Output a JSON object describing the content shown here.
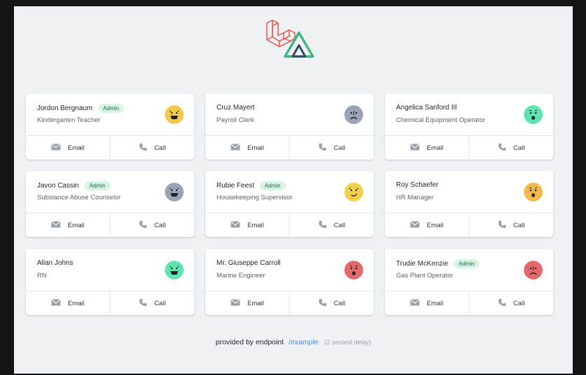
{
  "cards": [
    {
      "name": "Jordon Bergnaum",
      "admin": "Admin",
      "role": "Kindergarten Teacher",
      "avatar_color": "#f2c94c",
      "face": "bgrin"
    },
    {
      "name": "Cruz Mayert",
      "admin": "",
      "role": "Payroll Clerk",
      "avatar_color": "#9aa3b5",
      "face": "frown"
    },
    {
      "name": "Angelica Sanford III",
      "admin": "",
      "role": "Chemical Equipment Operator",
      "avatar_color": "#5fe3b0",
      "face": "o"
    },
    {
      "name": "Javon Cassin",
      "admin": "Admin",
      "role": "Substance Abuse Counselor",
      "avatar_color": "#9aa3b5",
      "face": "bgrin"
    },
    {
      "name": "Rubie Feest",
      "admin": "Admin",
      "role": "Housekeeping Supervisor",
      "avatar_color": "#f2d04c",
      "face": "smirk"
    },
    {
      "name": "Roy Schaefer",
      "admin": "",
      "role": "HR Manager",
      "avatar_color": "#f2b84c",
      "face": "o"
    },
    {
      "name": "Allan Johns",
      "admin": "",
      "role": "RN",
      "avatar_color": "#5fe3b0",
      "face": "bgrin"
    },
    {
      "name": "Mr. Giuseppe Carroll",
      "admin": "",
      "role": "Marine Engineer",
      "avatar_color": "#e36a6a",
      "face": "o"
    },
    {
      "name": "Trudie McKenzie",
      "admin": "Admin",
      "role": "Gas Plant Operator",
      "avatar_color": "#e36a6a",
      "face": "frown"
    }
  ],
  "actions": {
    "email": "Email",
    "call": "Call"
  },
  "footer": {
    "text": "provided by endpoint",
    "link": "/example",
    "delay": "(2 second delay)"
  },
  "icons": {
    "email": "mail-icon",
    "call": "phone-icon"
  },
  "colors": {
    "laravel": "#e8503d",
    "vue_green": "#41b883",
    "vue_dark": "#35495e",
    "badge_bg": "#d7f3e3",
    "badge_text": "#1f6b44",
    "link": "#4a8ee6"
  }
}
